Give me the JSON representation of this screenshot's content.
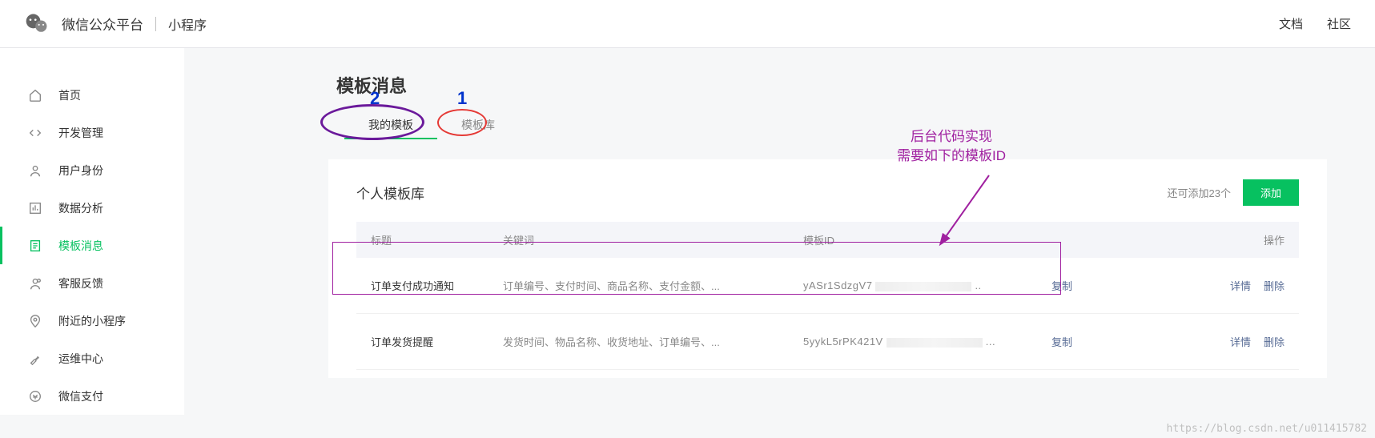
{
  "header": {
    "platform": "微信公众平台",
    "sub": "小程序",
    "links": [
      "文档",
      "社区"
    ]
  },
  "sidebar": {
    "items": [
      {
        "icon": "home",
        "label": "首页"
      },
      {
        "icon": "dev",
        "label": "开发管理"
      },
      {
        "icon": "user",
        "label": "用户身份"
      },
      {
        "icon": "chart",
        "label": "数据分析"
      },
      {
        "icon": "template",
        "label": "模板消息"
      },
      {
        "icon": "feedback",
        "label": "客服反馈"
      },
      {
        "icon": "nearby",
        "label": "附近的小程序"
      },
      {
        "icon": "ops",
        "label": "运维中心"
      },
      {
        "icon": "pay",
        "label": "微信支付"
      }
    ],
    "active_index": 4
  },
  "page": {
    "title": "模板消息",
    "tabs": [
      "我的模板",
      "模板库"
    ],
    "active_tab": 0
  },
  "panel": {
    "title": "个人模板库",
    "quota": "还可添加23个",
    "add_label": "添加",
    "columns": {
      "title": "标题",
      "keywords": "关键词",
      "id": "模板ID",
      "op": "操作"
    },
    "copy_label": "复制",
    "detail_label": "详情",
    "delete_label": "删除",
    "rows": [
      {
        "title": "订单支付成功通知",
        "keywords": "订单编号、支付时间、商品名称、支付金额、...",
        "id_prefix": "yASr1SdzgV7",
        "id_suffix": ".."
      },
      {
        "title": "订单发货提醒",
        "keywords": "发货时间、物品名称、收货地址、订单编号、...",
        "id_prefix": "5yykL5rPK421V",
        "id_suffix": "..."
      }
    ]
  },
  "annotations": {
    "num1": "1",
    "num2": "2",
    "note_line1": "后台代码实现",
    "note_line2": "需要如下的模板ID"
  },
  "watermark": "https://blog.csdn.net/u011415782"
}
